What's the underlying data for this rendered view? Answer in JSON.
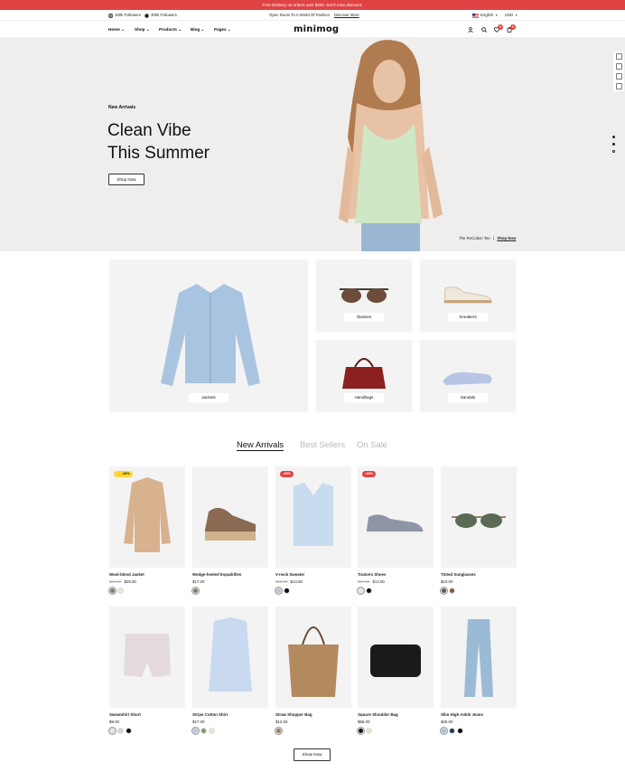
{
  "promo": {
    "text": "Free Delivery on orders over $200. Don't miss discount."
  },
  "topbar": {
    "followers1": "100k Followers",
    "followers2": "300k Followers",
    "tagline": "Open Doors To A World Of Fashion",
    "tagline_link": "Discover More",
    "language": "English",
    "currency": "USD"
  },
  "nav": {
    "items": [
      "Home",
      "Shop",
      "Products",
      "Blog",
      "Pages"
    ],
    "logo": "minimog",
    "wishlist_count": "0",
    "cart_count": "0"
  },
  "hero": {
    "eyebrow": "New Arrivals",
    "title_line1": "Clean Vibe",
    "title_line2": "This Summer",
    "button": "Shop Now",
    "caption": "The ReCotton Tee",
    "caption_link": "Shop Now"
  },
  "categories": [
    "Jackets",
    "Glasses",
    "Sneakers",
    "Handbags",
    "Sandals"
  ],
  "tabs": [
    "New Arrivals",
    "Best Sellers",
    "On Sale"
  ],
  "products": [
    {
      "name": "Wool-blend Jacket",
      "old_price": "$41.00",
      "price": "$29.00",
      "badge": "-26%",
      "swatches": [
        "#8a7766",
        "#e9e5df"
      ]
    },
    {
      "name": "Wedge-heeled Espadrilles",
      "old_price": "",
      "price": "$17.00",
      "badge": "",
      "swatches": [
        "#8a7766"
      ]
    },
    {
      "name": "V-neck Sweater",
      "old_price": "$16.00",
      "price": "$13.00",
      "badge": "-19%",
      "swatches": [
        "#b9c9db",
        "#111111"
      ]
    },
    {
      "name": "Trainers Shoes",
      "old_price": "$17.00",
      "price": "$14.00",
      "badge": "-18%",
      "swatches": [
        "#e9e5df",
        "#111111"
      ]
    },
    {
      "name": "Tinted Sunglasses",
      "old_price": "",
      "price": "$10.00",
      "badge": "",
      "swatches": [
        "#5b5e56",
        "#8a5a3c"
      ]
    },
    {
      "name": "Sweatshirt Short",
      "old_price": "",
      "price": "$9.00",
      "badge": "",
      "swatches": [
        "#e8e3e6",
        "#d5d5d5",
        "#111111"
      ]
    },
    {
      "name": "Stripe Cotton Shirt",
      "old_price": "",
      "price": "$17.00",
      "badge": "",
      "swatches": [
        "#b9c9db",
        "#7f9a6a",
        "#e8e4d2"
      ]
    },
    {
      "name": "Straw Shopper Bag",
      "old_price": "",
      "price": "$12.00",
      "badge": "",
      "swatches": [
        "#9a8066"
      ]
    },
    {
      "name": "Square Shoulder Bag",
      "old_price": "",
      "price": "$55.00",
      "badge": "",
      "swatches": [
        "#111111",
        "#e8e4d2"
      ]
    },
    {
      "name": "Slim High Ankle Jeans",
      "old_price": "",
      "price": "$25.00",
      "badge": "",
      "swatches": [
        "#a7c1d8",
        "#1d3a5b",
        "#111111"
      ]
    }
  ],
  "show_now": "Show Now",
  "colors": {
    "accent": "#e04344",
    "badge_yellow": "#ffd834"
  }
}
